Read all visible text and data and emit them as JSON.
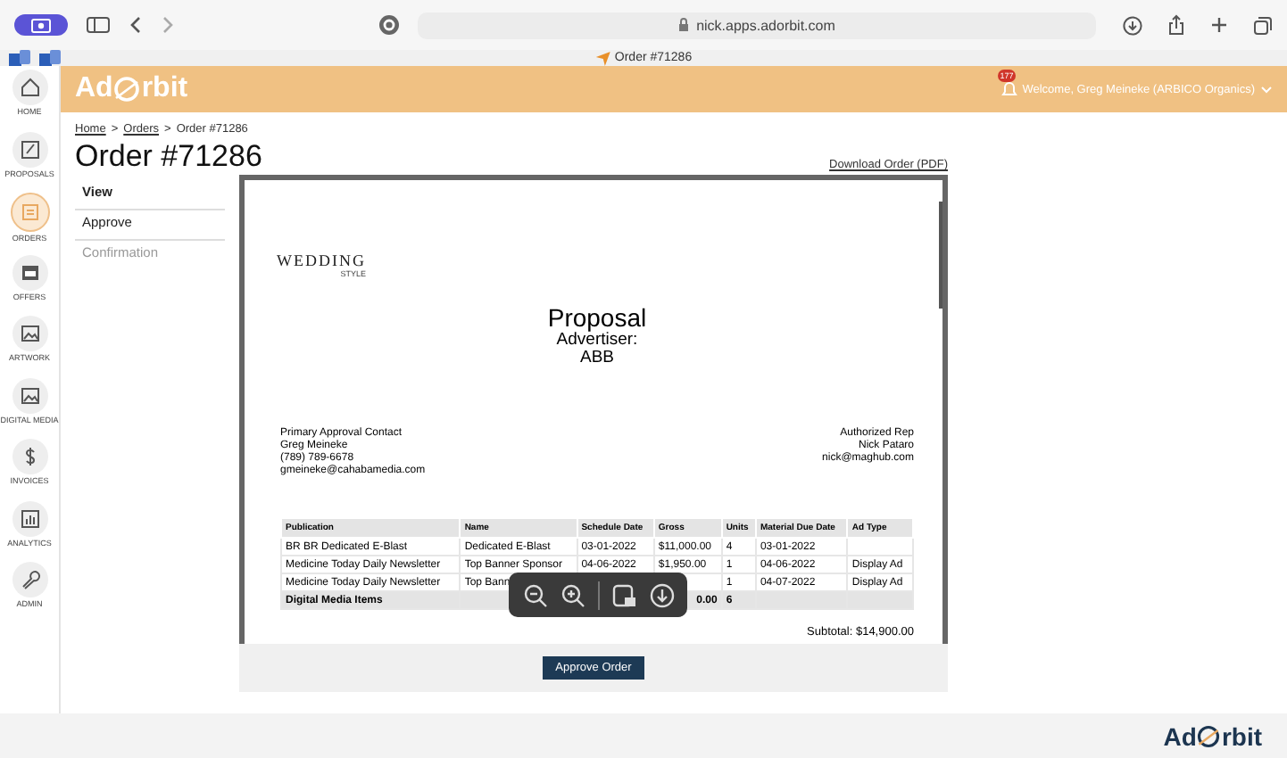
{
  "browser": {
    "url": "nick.apps.adorbit.com",
    "tab_title": "Order #71286"
  },
  "header": {
    "logo": {
      "before": "Ad",
      "after": "rbit"
    },
    "notification_count": "177",
    "welcome": "Welcome, Greg Meineke (ARBICO Organics)"
  },
  "sidebar": {
    "items": [
      {
        "label": "HOME",
        "selected": false
      },
      {
        "label": "PROPOSALS",
        "selected": false
      },
      {
        "label": "ORDERS",
        "selected": true
      },
      {
        "label": "OFFERS",
        "selected": false
      },
      {
        "label": "ARTWORK",
        "selected": false
      },
      {
        "label": "DIGITAL MEDIA",
        "selected": false
      },
      {
        "label": "INVOICES",
        "selected": false
      },
      {
        "label": "ANALYTICS",
        "selected": false
      },
      {
        "label": "ADMIN",
        "selected": false
      }
    ]
  },
  "breadcrumb": {
    "items": [
      {
        "label": "Home",
        "link": true
      },
      {
        "label": "Orders",
        "link": true
      },
      {
        "label": "Order #71286",
        "link": false
      }
    ],
    "separator": ">"
  },
  "title": "Order #71286",
  "steps": [
    {
      "label": "View",
      "selected": true,
      "disabled": false
    },
    {
      "label": "Approve",
      "selected": false,
      "disabled": false
    },
    {
      "label": "Confirmation",
      "selected": false,
      "disabled": true
    }
  ],
  "download_link": "Download Order (PDF)",
  "document": {
    "publication_logo": {
      "name": "WEDDING",
      "sub": "STYLE"
    },
    "heading": "Proposal",
    "advertiser_label": "Advertiser:",
    "advertiser": "ABB",
    "contact": [
      "Primary Approval Contact",
      "Greg Meineke",
      "(789) 789-6678",
      "gmeineke@cahabamedia.com"
    ],
    "rep": [
      "Authorized Rep",
      "Nick Pataro",
      "nick@maghub.com"
    ],
    "table": {
      "columns": [
        "Publication",
        "Name",
        "Schedule Date",
        "Gross",
        "Units",
        "Material Due Date",
        "Ad Type"
      ],
      "rows": [
        {
          "total": false,
          "cells": [
            "BR BR Dedicated E-Blast",
            "Dedicated E-Blast",
            "03-01-2022",
            "$11,000.00",
            "4",
            "03-01-2022",
            null
          ]
        },
        {
          "total": false,
          "cells": [
            "Medicine Today Daily Newsletter",
            "Top Banner Sponsor",
            "04-06-2022",
            "$1,950.00",
            "1",
            "04-06-2022",
            "Display Ad"
          ]
        },
        {
          "total": false,
          "cells": [
            "Medicine Today Daily Newsletter",
            "Top Bann",
            null,
            null,
            "1",
            "04-07-2022",
            "Display Ad"
          ]
        },
        {
          "total": true,
          "cells": [
            "Digital Media Items",
            null,
            null,
            "0.00",
            "6",
            null,
            null
          ]
        }
      ]
    },
    "subtotal": "Subtotal: $14,900.00"
  },
  "approve_button": "Approve Order",
  "footer_logo": {
    "before": "Ad",
    "after": "rbit"
  }
}
